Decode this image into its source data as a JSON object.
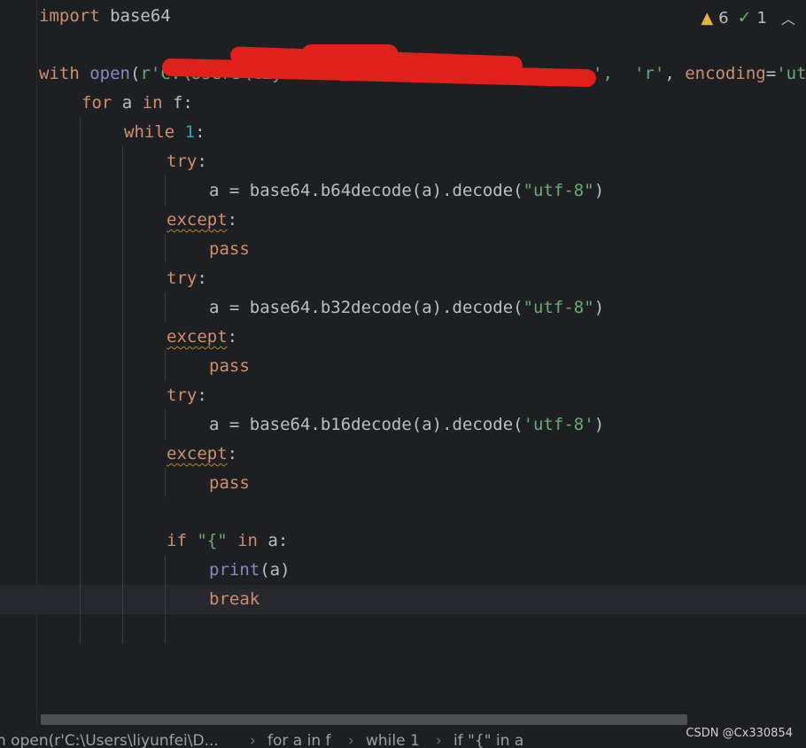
{
  "inspections": {
    "warning_count": "6",
    "check_count": "1"
  },
  "code": {
    "l1_import": "import",
    "l1_module": " base64",
    "l3_with": "with",
    "l3_open": "open",
    "l3_paren": "(",
    "l3_path": "r'C:\\Users\\liyunfei\\D...",
    "l3_tail_a": "', ",
    "l3_mode": "'r'",
    "l3_comma": ", ",
    "l3_enc": "encoding",
    "l3_eq": "=",
    "l3_encval": "'ut",
    "l4_for": "for",
    "l4_a": " a ",
    "l4_in": "in",
    "l4_f": " f:",
    "l5_while": "while",
    "l5_sp": " ",
    "l5_one": "1",
    "l5_colon": ":",
    "try": "try",
    "colon": ":",
    "l7_pre": "a = base64.b64decode(a).decode(",
    "l7_str": "\"utf-8\"",
    "close": ")",
    "except": "except",
    "pass": "pass",
    "l10_pre": "a = base64.b32decode(a).decode(",
    "l10_str": "\"utf-8\"",
    "l13_pre": "a = base64.b16decode(a).decode(",
    "l13_str": "'utf-8'",
    "if": "if",
    "l17_str": " \"{\" ",
    "l17_in": "in",
    "l17_a": " a:",
    "print": "print",
    "l18_args": "(a)",
    "break": "break"
  },
  "breadcrumb": {
    "item1": "h open(r'C:\\Users\\liyunfei\\D...",
    "item2": "for a in f",
    "item3": "while 1",
    "item4": "if \"{\" in a",
    "separator": "›"
  },
  "watermark": "CSDN @Cx330854",
  "colors": {
    "keyword": "#cf8e6d",
    "string": "#6aab73",
    "number": "#2aacb8",
    "builtin": "#8888c6",
    "default": "#bcbec4",
    "redaction": "#e0201b"
  }
}
